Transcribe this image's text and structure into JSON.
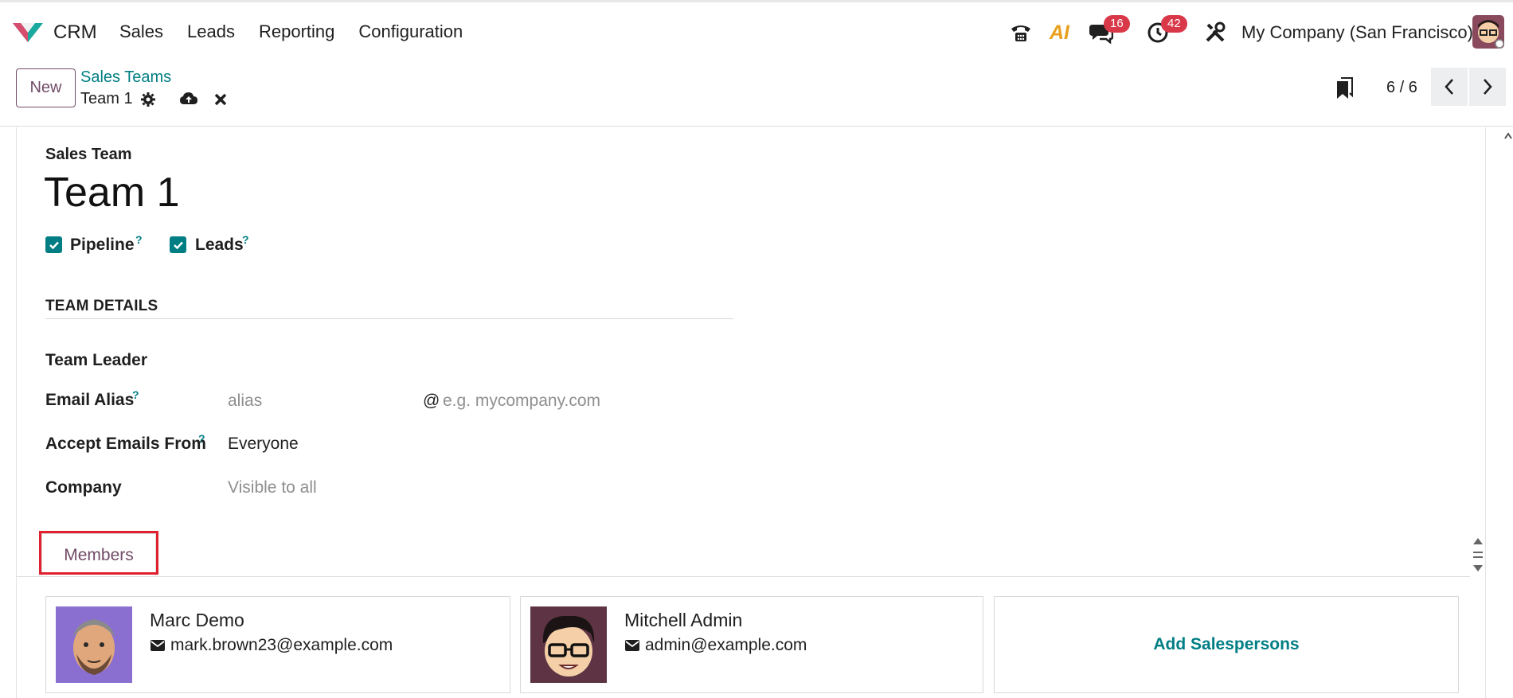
{
  "navbar": {
    "app_name": "CRM",
    "menu": [
      "Sales",
      "Leads",
      "Reporting",
      "Configuration"
    ],
    "messages_count": "16",
    "activities_count": "42",
    "ai_label": "AI",
    "company": "My Company (San Francisco)"
  },
  "control_panel": {
    "new_label": "New",
    "breadcrumb_parent": "Sales Teams",
    "breadcrumb_current": "Team 1",
    "pager": "6 / 6"
  },
  "form": {
    "header_label": "Sales Team",
    "title": "Team 1",
    "checkboxes": [
      {
        "label": "Pipeline",
        "checked": true,
        "help": "?"
      },
      {
        "label": "Leads",
        "checked": true,
        "help": "?"
      }
    ],
    "section_title": "TEAM DETAILS",
    "fields": {
      "team_leader": {
        "label": "Team Leader",
        "value": ""
      },
      "email_alias": {
        "label": "Email Alias",
        "help": "?",
        "alias_placeholder": "alias",
        "at": "@",
        "domain_placeholder": "e.g. mycompany.com"
      },
      "accept_from": {
        "label": "Accept Emails From",
        "help": "?",
        "value": "Everyone"
      },
      "company": {
        "label": "Company",
        "placeholder": "Visible to all"
      }
    },
    "tabs": [
      "Members"
    ],
    "members": [
      {
        "name": "Marc Demo",
        "email": "mark.brown23@example.com"
      },
      {
        "name": "Mitchell Admin",
        "email": "admin@example.com"
      }
    ],
    "add_salespersons": "Add Salespersons"
  },
  "colors": {
    "primary": "#714b67",
    "accent": "#017e84",
    "badge": "#d93849",
    "highlight": "#e0202e"
  }
}
